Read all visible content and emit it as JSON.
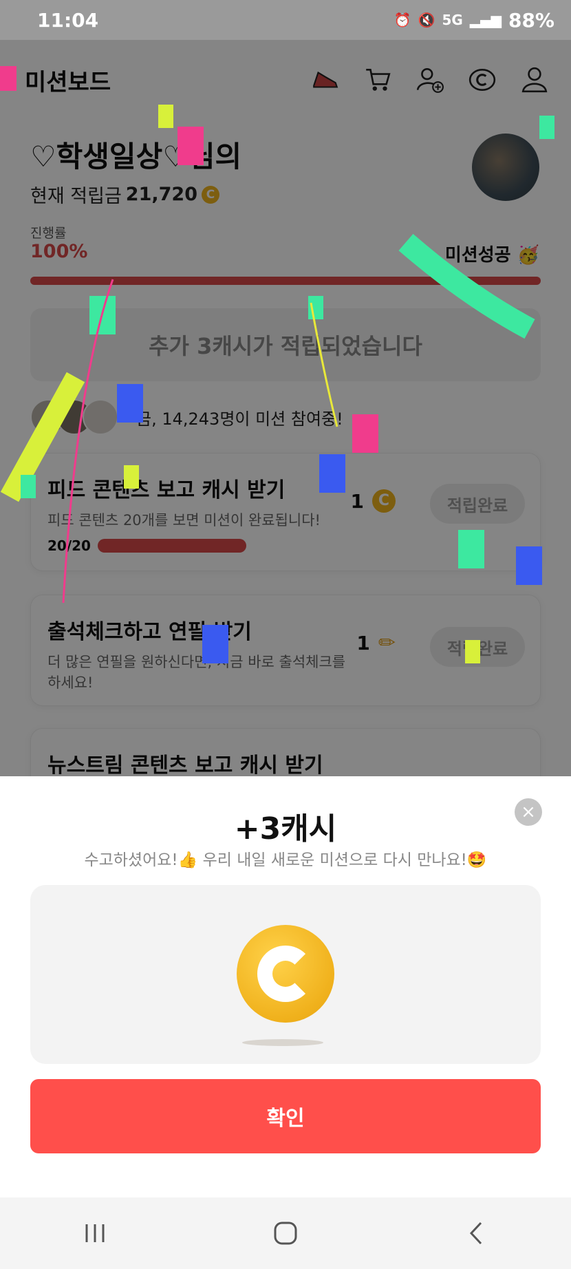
{
  "status_bar": {
    "time": "11:04",
    "network": "5G",
    "battery": "88%"
  },
  "header": {
    "brand": "미션보드",
    "icons": [
      "sneaker-icon",
      "cart-icon",
      "add-friend-icon",
      "cash-icon",
      "profile-icon"
    ]
  },
  "profile": {
    "nickname": "♡학생일상♡님의",
    "balance_label": "현재 적립금",
    "balance_value": "21,720",
    "coin_symbol": "C"
  },
  "progress": {
    "label": "진행률",
    "value_text": "100%",
    "fraction": 1.0,
    "status": "미션성공 🥳"
  },
  "banner": {
    "text": "추가 3캐시가 적립되었습니다"
  },
  "participants": {
    "text": "금, 14,243명이 미션 참여중!"
  },
  "missions": [
    {
      "title": "피드 콘텐츠 보고 캐시 받기",
      "desc": "피드 콘텐츠 20개를 보면 미션이 완료됩니다!",
      "progress_text": "20/20",
      "progress_fraction": 1.0,
      "reward": "1",
      "reward_type": "coin",
      "button": "적립완료"
    },
    {
      "title": "출석체크하고 연필 받기",
      "desc": "더 많은 연필을 원하신다면, 지금 바로 출석체크를 하세요!",
      "reward": "1",
      "reward_type": "pencil",
      "button": "적립완료"
    },
    {
      "title": "뉴스트림 콘텐츠 보고 캐시 받기"
    }
  ],
  "sheet": {
    "title": "+3캐시",
    "subtitle": "수고하셨어요!👍 우리 내일 새로운 미션으로 다시 만나요!🤩",
    "close_icon": "×",
    "confirm": "확인"
  },
  "colors": {
    "accent": "#ff4f4b",
    "progress": "#d94a4a",
    "coin": "#f0b51e"
  }
}
